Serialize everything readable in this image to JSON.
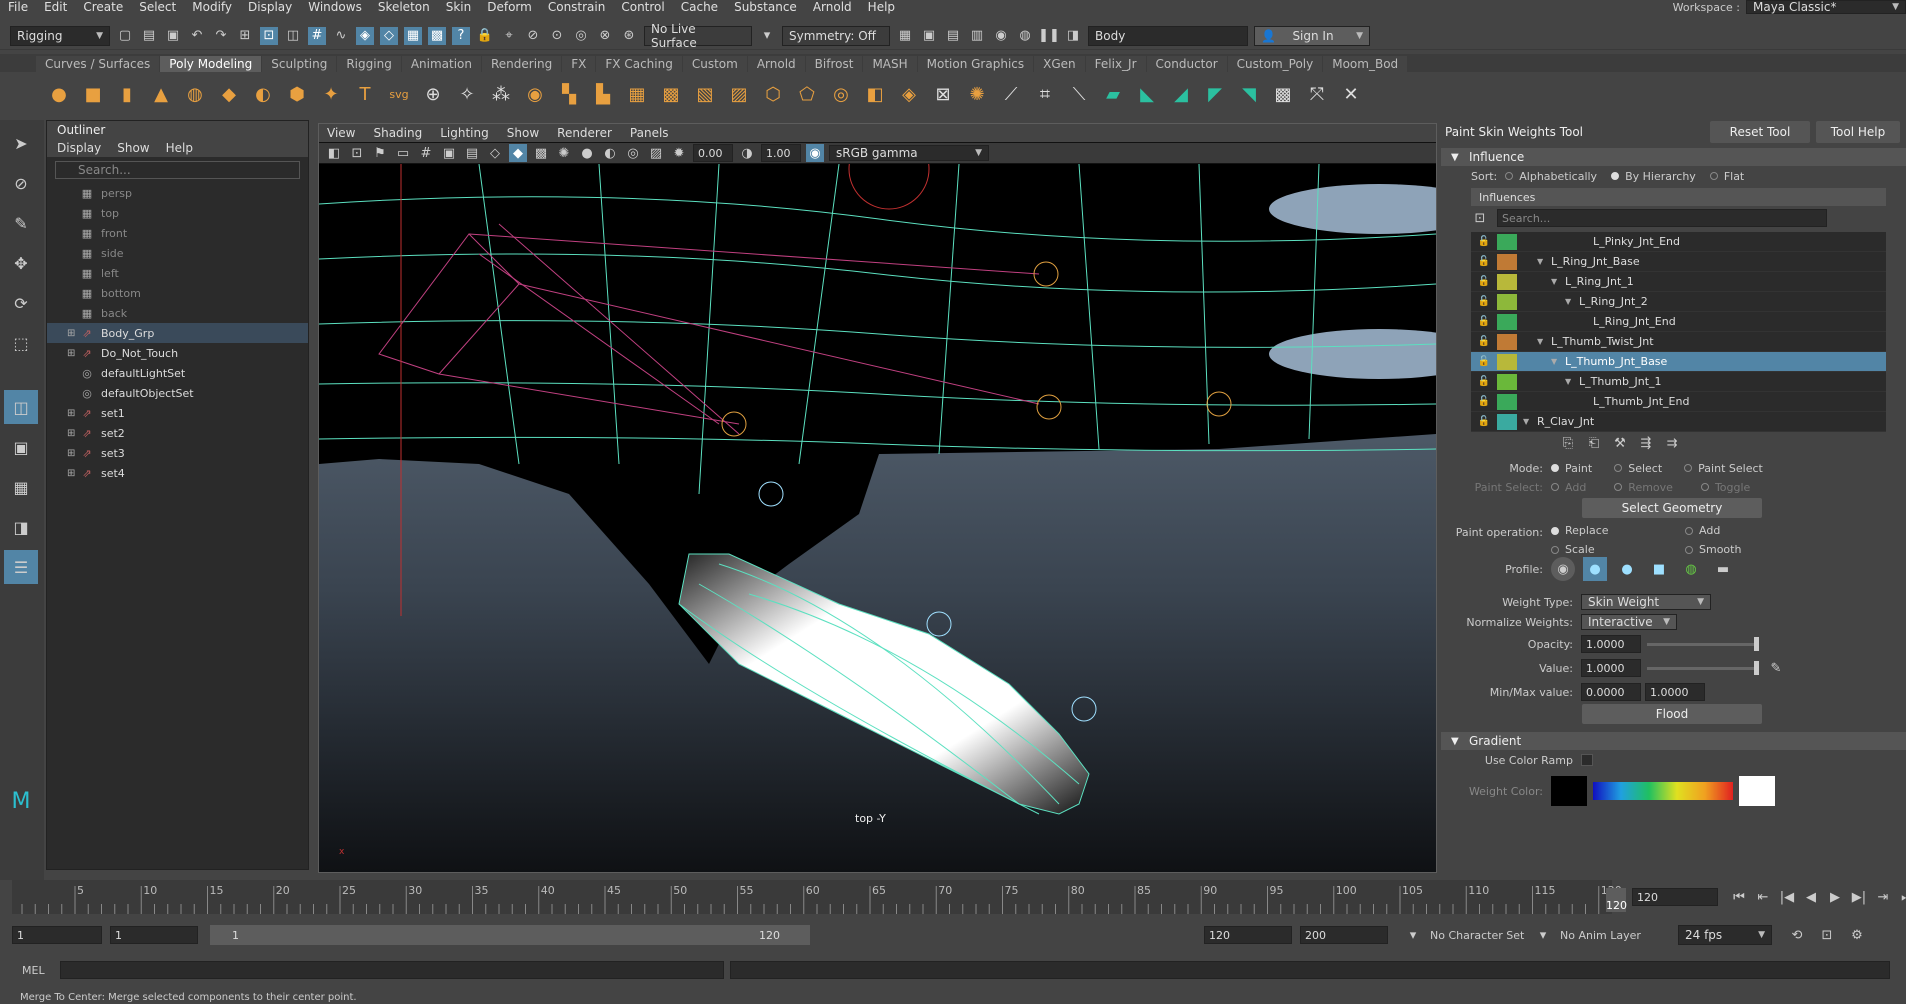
{
  "menubar": {
    "items": [
      "File",
      "Edit",
      "Create",
      "Select",
      "Modify",
      "Display",
      "Windows",
      "Skeleton",
      "Skin",
      "Deform",
      "Constrain",
      "Control",
      "Cache",
      "Substance",
      "Arnold",
      "Help"
    ],
    "workspace_label": "Workspace :",
    "workspace_value": "Maya Classic*"
  },
  "statusline": {
    "menuset": "Rigging",
    "live_surface": "No Live Surface",
    "symmetry": "Symmetry: Off",
    "name_field": "Body",
    "sign_in": "Sign In"
  },
  "shelf": {
    "tabs": [
      "Curves / Surfaces",
      "Poly Modeling",
      "Sculpting",
      "Rigging",
      "Animation",
      "Rendering",
      "FX",
      "FX Caching",
      "Custom",
      "Arnold",
      "Bifrost",
      "MASH",
      "Motion Graphics",
      "XGen",
      "Felix_Jr",
      "Conductor",
      "Custom_Poly",
      "Moom_Bod"
    ],
    "active_tab": "Poly Modeling"
  },
  "outliner": {
    "title": "Outliner",
    "menu": [
      "Display",
      "Show",
      "Help"
    ],
    "search_placeholder": "Search...",
    "items": [
      {
        "label": "persp",
        "dim": true,
        "expand": ""
      },
      {
        "label": "top",
        "dim": true,
        "expand": ""
      },
      {
        "label": "front",
        "dim": true,
        "expand": ""
      },
      {
        "label": "side",
        "dim": true,
        "expand": ""
      },
      {
        "label": "left",
        "dim": true,
        "expand": ""
      },
      {
        "label": "bottom",
        "dim": true,
        "expand": ""
      },
      {
        "label": "back",
        "dim": true,
        "expand": ""
      },
      {
        "label": "Body_Grp",
        "dim": false,
        "expand": "+",
        "selected": true
      },
      {
        "label": "Do_Not_Touch",
        "dim": false,
        "expand": "+"
      },
      {
        "label": "defaultLightSet",
        "dim": false,
        "expand": ""
      },
      {
        "label": "defaultObjectSet",
        "dim": false,
        "expand": ""
      },
      {
        "label": "set1",
        "dim": false,
        "expand": "+"
      },
      {
        "label": "set2",
        "dim": false,
        "expand": "+"
      },
      {
        "label": "set3",
        "dim": false,
        "expand": "+"
      },
      {
        "label": "set4",
        "dim": false,
        "expand": "+"
      }
    ]
  },
  "viewport": {
    "menu": [
      "View",
      "Shading",
      "Lighting",
      "Show",
      "Renderer",
      "Panels"
    ],
    "exposure": "0.00",
    "gamma": "1.00",
    "colorspace": "sRGB gamma",
    "camera_label": "top -Y"
  },
  "tool_settings": {
    "title": "Paint Skin Weights Tool",
    "reset_button": "Reset Tool",
    "help_button": "Tool Help",
    "influence_header": "Influence",
    "sort_label": "Sort:",
    "sort_options": [
      "Alphabetically",
      "By Hierarchy",
      "Flat"
    ],
    "sort_selected": "By Hierarchy",
    "influences_header": "Influences",
    "influence_search_placeholder": "Search...",
    "influences": [
      {
        "label": "L_Pinky_Jnt_End",
        "indent": 4,
        "color": "#3aa95a",
        "arrow": ""
      },
      {
        "label": "L_Ring_Jnt_Base",
        "indent": 1,
        "color": "#c07a35",
        "arrow": "▼"
      },
      {
        "label": "L_Ring_Jnt_1",
        "indent": 2,
        "color": "#b8b83a",
        "arrow": "▼"
      },
      {
        "label": "L_Ring_Jnt_2",
        "indent": 3,
        "color": "#8db83a",
        "arrow": "▼"
      },
      {
        "label": "L_Ring_Jnt_End",
        "indent": 4,
        "color": "#3aa95a",
        "arrow": ""
      },
      {
        "label": "L_Thumb_Twist_Jnt",
        "indent": 1,
        "color": "#c07a35",
        "arrow": "▼"
      },
      {
        "label": "L_Thumb_Jnt_Base",
        "indent": 2,
        "color": "#b8b83a",
        "arrow": "▼",
        "selected": true
      },
      {
        "label": "L_Thumb_Jnt_1",
        "indent": 3,
        "color": "#6ab83a",
        "arrow": "▼"
      },
      {
        "label": "L_Thumb_Jnt_End",
        "indent": 4,
        "color": "#3aa95a",
        "arrow": ""
      },
      {
        "label": "R_Clav_Jnt",
        "indent": 0,
        "color": "#3aaaa0",
        "arrow": "▼"
      }
    ],
    "mode_label": "Mode:",
    "mode_options": [
      "Paint",
      "Select",
      "Paint Select"
    ],
    "mode_selected": "Paint",
    "paint_select_label": "Paint Select:",
    "paint_select_options": [
      "Add",
      "Remove",
      "Toggle"
    ],
    "select_geometry_button": "Select Geometry",
    "paint_op_label": "Paint operation:",
    "paint_op_options": [
      "Replace",
      "Add",
      "Scale",
      "Smooth"
    ],
    "paint_op_selected": "Replace",
    "profile_label": "Profile:",
    "weight_type_label": "Weight Type:",
    "weight_type_value": "Skin Weight",
    "normalize_label": "Normalize Weights:",
    "normalize_value": "Interactive",
    "opacity_label": "Opacity:",
    "opacity_value": "1.0000",
    "value_label": "Value:",
    "value_value": "1.0000",
    "minmax_label": "Min/Max value:",
    "min_value": "0.0000",
    "max_value": "1.0000",
    "flood_button": "Flood",
    "gradient_header": "Gradient",
    "use_color_ramp_label": "Use Color Ramp",
    "weight_color_label": "Weight Color:"
  },
  "timeline": {
    "ticks": [
      "5",
      "10",
      "15",
      "20",
      "25",
      "30",
      "35",
      "40",
      "45",
      "50",
      "55",
      "60",
      "65",
      "70",
      "75",
      "80",
      "85",
      "90",
      "95",
      "100",
      "105",
      "110",
      "115",
      "120"
    ],
    "current_frame": "120",
    "current_field": "120"
  },
  "range": {
    "start": "1",
    "start2": "1",
    "slider_start": "1",
    "slider_end": "120",
    "end": "120",
    "end2": "200",
    "character_set": "No Character Set",
    "anim_layer": "No Anim Layer",
    "fps": "24 fps"
  },
  "cmdline": {
    "mel_label": "MEL"
  },
  "helpline": {
    "text": "Merge To Center: Merge selected components to their center point."
  },
  "colors": {
    "accent": "#5285a6",
    "wire_cyan": "#5ce0c0",
    "wire_magenta": "#c04080"
  }
}
